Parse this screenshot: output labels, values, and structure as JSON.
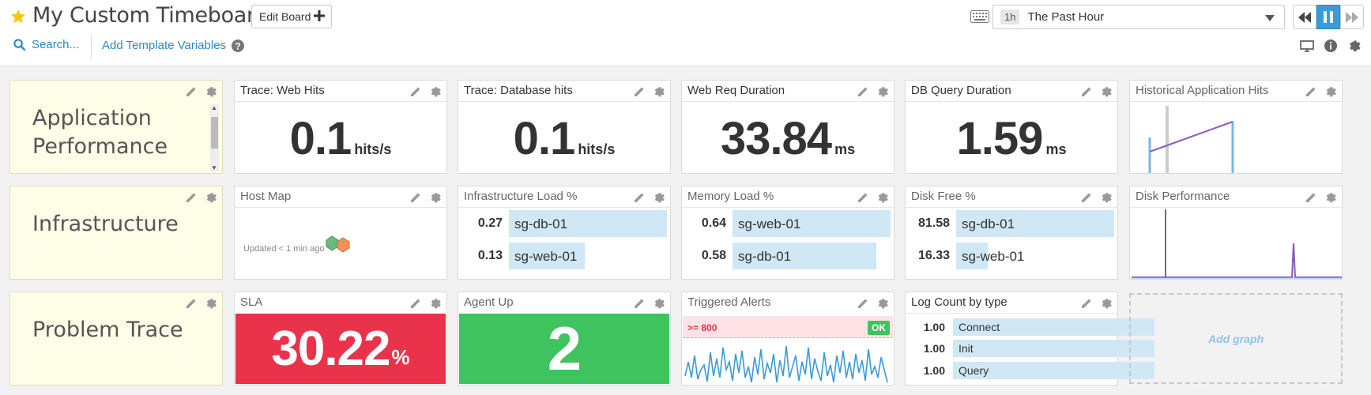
{
  "header": {
    "title": "My Custom Timeboard",
    "edit_board_label": "Edit Board",
    "search_label": "Search...",
    "template_vars_label": "Add Template Variables",
    "time_badge": "1h",
    "time_label": "The Past Hour",
    "accent_color": "#3a9bd9",
    "star_color": "#f5c518"
  },
  "notes": {
    "row1": [
      "Application",
      "Performance"
    ],
    "row2": "Infrastructure",
    "row3": "Problem Trace"
  },
  "widgets": {
    "trace_web": {
      "title": "Trace: Web Hits",
      "value": "0.1",
      "unit": "hits/s"
    },
    "trace_db": {
      "title": "Trace: Database hits",
      "value": "0.1",
      "unit": "hits/s"
    },
    "web_req": {
      "title": "Web Req Duration",
      "value": "33.84",
      "unit": "ms"
    },
    "db_query": {
      "title": "DB Query Duration",
      "value": "1.59",
      "unit": "ms"
    },
    "historical": {
      "title": "Historical Application Hits"
    },
    "host_map": {
      "title": "Host Map",
      "updated": "Updated < 1 min ago"
    },
    "infra_load": {
      "title": "Infrastructure Load %",
      "rows": [
        {
          "value": "0.27",
          "label": "sg-db-01",
          "fraction": 1.0
        },
        {
          "value": "0.13",
          "label": "sg-web-01",
          "fraction": 0.48
        }
      ]
    },
    "memory_load": {
      "title": "Memory Load %",
      "rows": [
        {
          "value": "0.64",
          "label": "sg-web-01",
          "fraction": 1.0
        },
        {
          "value": "0.58",
          "label": "sg-db-01",
          "fraction": 0.91
        }
      ]
    },
    "disk_free": {
      "title": "Disk Free %",
      "rows": [
        {
          "value": "81.58",
          "label": "sg-db-01",
          "fraction": 1.0
        },
        {
          "value": "16.33",
          "label": "sg-web-01",
          "fraction": 0.2
        }
      ]
    },
    "disk_perf": {
      "title": "Disk Performance"
    },
    "sla": {
      "title": "SLA",
      "value": "30.22",
      "unit": "%",
      "color": "#e8334a"
    },
    "agent_up": {
      "title": "Agent Up",
      "value": "2",
      "color": "#3ec35f"
    },
    "alerts": {
      "title": "Triggered Alerts",
      "threshold": ">= 800",
      "status": "OK"
    },
    "log_count": {
      "title": "Log Count by type",
      "rows": [
        {
          "value": "1.00",
          "label": "Connect"
        },
        {
          "value": "1.00",
          "label": "Init"
        },
        {
          "value": "1.00",
          "label": "Query"
        }
      ]
    },
    "add_graph": "Add graph"
  }
}
